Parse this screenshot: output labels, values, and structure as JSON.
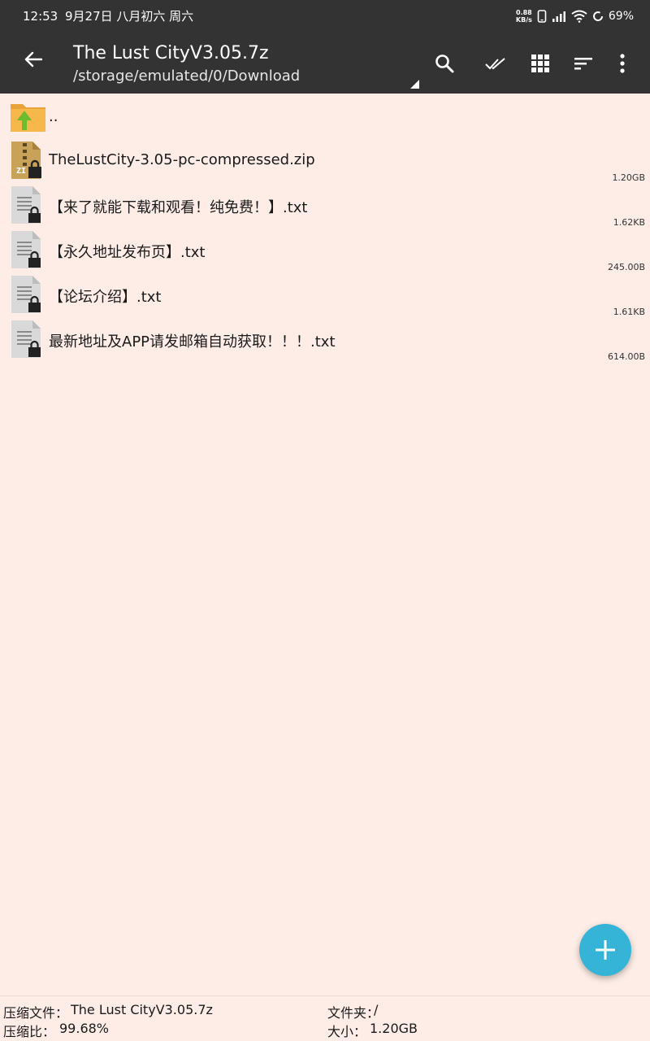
{
  "status_bar": {
    "time": "12:53",
    "date": "9月27日 八月初六 周六",
    "net_speed_value": "0.88",
    "net_speed_unit": "KB/s",
    "battery": "69%"
  },
  "app_bar": {
    "title": "The Lust CityV3.05.7z",
    "path": "/storage/emulated/0/Download"
  },
  "files": [
    {
      "name": "..",
      "size": "",
      "type": "parent-folder"
    },
    {
      "name": "TheLustCity-3.05-pc-compressed.zip",
      "size": "1.20GB",
      "type": "zip",
      "icon_label": "ZI"
    },
    {
      "name": "【来了就能下载和观看！纯免费！】.txt",
      "size": "1.62KB",
      "type": "txt"
    },
    {
      "name": "【永久地址发布页】.txt",
      "size": "245.00B",
      "type": "txt"
    },
    {
      "name": "【论坛介绍】.txt",
      "size": "1.61KB",
      "type": "txt"
    },
    {
      "name": "最新地址及APP请发邮箱自动获取！！！.txt",
      "size": "614.00B",
      "type": "txt"
    }
  ],
  "footer": {
    "archive_label": "压缩文件：",
    "archive_value": "The Lust CityV3.05.7z",
    "folder_label": "文件夹：",
    "folder_value": "/",
    "ratio_label": "压缩比：",
    "ratio_value": "99.68%",
    "size_label": "大小：",
    "size_value": "1.20GB"
  },
  "colors": {
    "toolbar": "#333333",
    "background": "#fdede6",
    "fab": "#36b4d8"
  }
}
